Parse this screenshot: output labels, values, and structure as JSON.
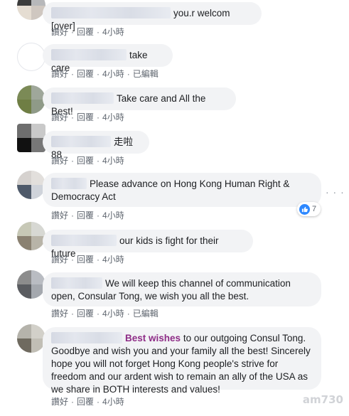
{
  "actions": {
    "like": "讚好",
    "reply": "回覆",
    "edited": "已編輯",
    "sep": "·"
  },
  "comments": [
    {
      "text": "you.r welcom [over]",
      "time": "4小時",
      "edited": false
    },
    {
      "text": "take care",
      "time": "4小時",
      "edited": true
    },
    {
      "text": "Take care and All the Best!",
      "time": "4小時",
      "edited": false
    },
    {
      "text": "走啦88",
      "time": "4小時",
      "edited": false
    },
    {
      "text": "Please advance on Hong Kong Human Right & Democracy Act",
      "time": "4小時",
      "edited": false,
      "reactions": "7",
      "reaction_icon": "like-icon"
    },
    {
      "text": "our kids is fight for their future",
      "time": "4小時",
      "edited": false
    },
    {
      "text": "We will keep this channel of communication open, Consular Tong, we wish you all the best.",
      "time": "4小時",
      "edited": true
    },
    {
      "name": "Best wishes",
      "text": "to our outgoing Consul Tong. Goodbye and wish you and your family all the best! Sincerely hope you will not forget Hong Kong people's strive for freedom and our ardent wish to remain an ally of the USA as we share in BOTH interests and values!",
      "time": "4小時",
      "edited": false
    }
  ],
  "more_options": "· · ·",
  "watermark": "am730",
  "colors": {
    "bubble": "#f2f3f5",
    "meta": "#606770",
    "like_blue": "#2d88ff",
    "name": "#8e2d87"
  }
}
